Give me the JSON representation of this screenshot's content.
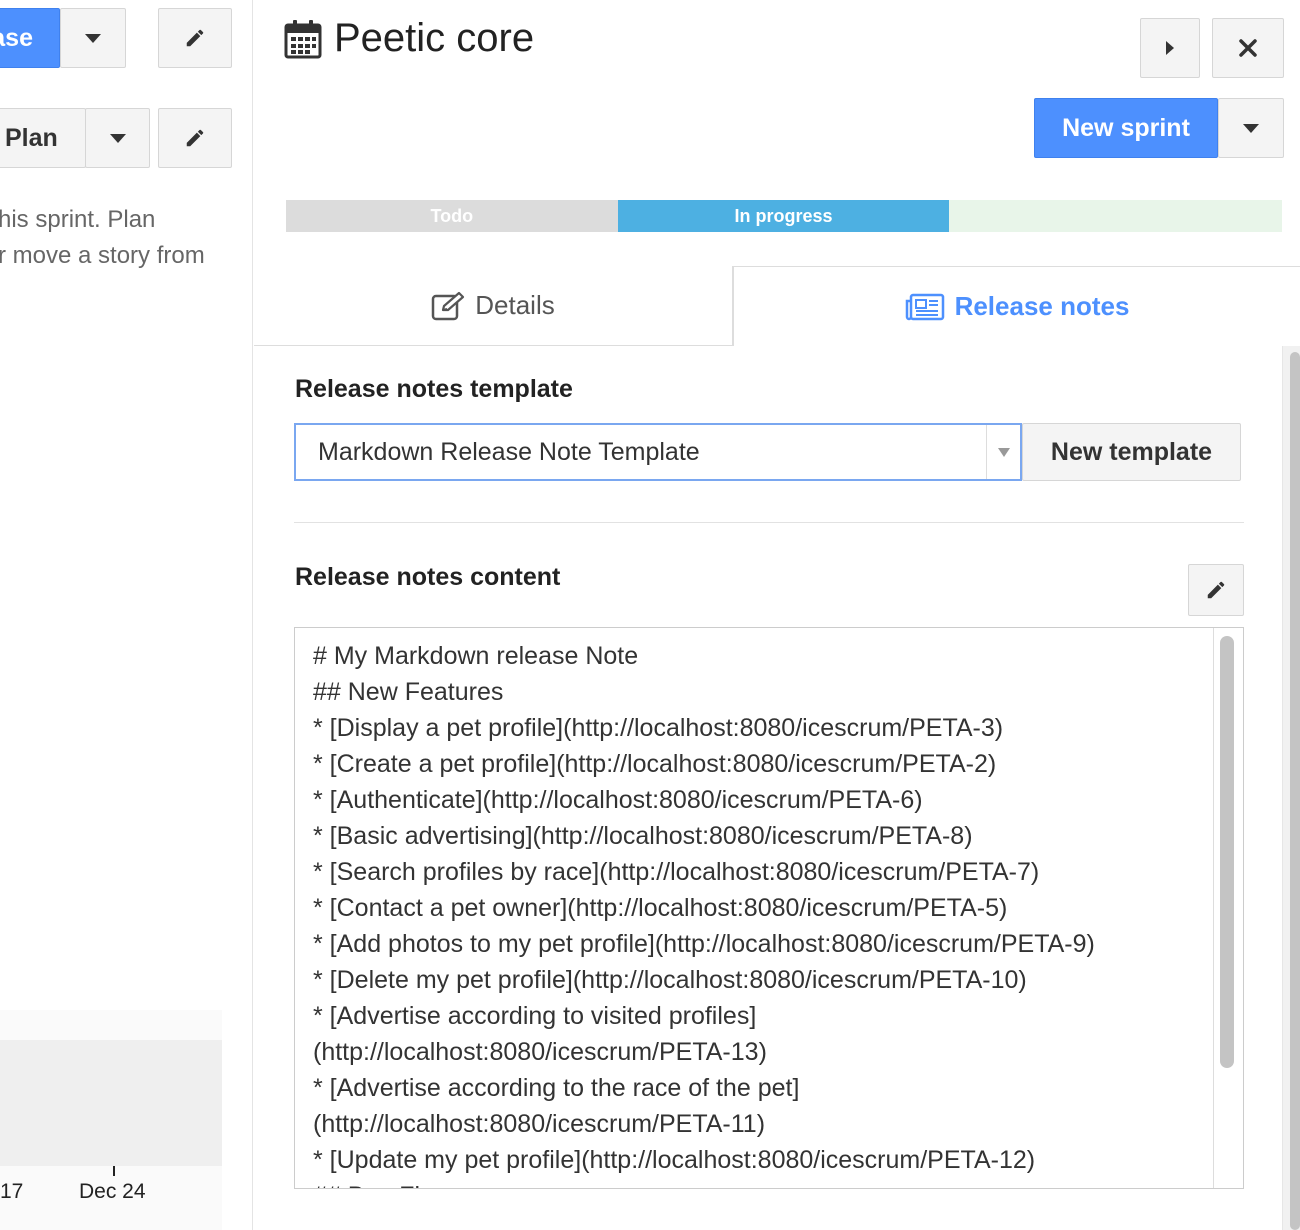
{
  "left": {
    "release_button_label": "ase",
    "plan_button_label": "Plan",
    "hint_line1": "his sprint. Plan",
    "hint_line2": "r move a story from",
    "axis_ticks": [
      "17",
      "Dec 24"
    ]
  },
  "panel": {
    "title": "Peetic core",
    "title_icon": "calendar-icon",
    "nav_next_icon": "caret-right-icon",
    "close_icon": "close-icon",
    "new_sprint_label": "New sprint",
    "progress": [
      {
        "label": "Todo",
        "fraction": 0.333,
        "color": "#dcdcdc"
      },
      {
        "label": "In progress",
        "fraction": 0.333,
        "color": "#4db0e2"
      },
      {
        "label": "",
        "fraction": 0.334,
        "color": "#e8f5e9"
      }
    ],
    "tabs": [
      {
        "label": "Details",
        "icon": "edit-icon",
        "active": false
      },
      {
        "label": "Release notes",
        "icon": "newspaper-icon",
        "active": true
      }
    ],
    "template_section_title": "Release notes template",
    "template_select_value": "Markdown Release Note Template",
    "new_template_label": "New template",
    "content_section_title": "Release notes content",
    "content_lines": [
      "# My Markdown release Note",
      "## New Features",
      "* [Display a pet profile](http://localhost:8080/icescrum/PETA-3)",
      "* [Create a pet profile](http://localhost:8080/icescrum/PETA-2)",
      "* [Authenticate](http://localhost:8080/icescrum/PETA-6)",
      "* [Basic advertising](http://localhost:8080/icescrum/PETA-8)",
      "* [Search profiles by race](http://localhost:8080/icescrum/PETA-7)",
      "* [Contact a pet owner](http://localhost:8080/icescrum/PETA-5)",
      "* [Add photos to my pet profile](http://localhost:8080/icescrum/PETA-9)",
      "* [Delete my pet profile](http://localhost:8080/icescrum/PETA-10)",
      "* [Advertise according to visited profiles]",
      "(http://localhost:8080/icescrum/PETA-13)",
      "* [Advertise according to the race of the pet]",
      "(http://localhost:8080/icescrum/PETA-11)",
      "* [Update my pet profile](http://localhost:8080/icescrum/PETA-12)",
      "## Bug Fixes"
    ]
  }
}
